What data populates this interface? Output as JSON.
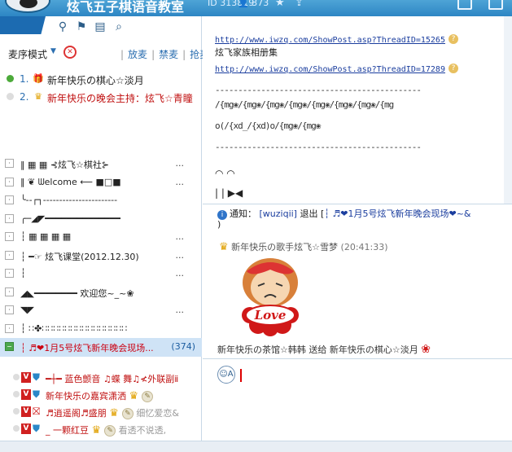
{
  "titlebar": {
    "app_title": "炫飞五子棋语音教室",
    "room_id": "ID 313819",
    "user_count": "373",
    "star_icon": "star-icon",
    "share_icon": "share-icon"
  },
  "toolbar": {
    "icons": [
      "people-icon",
      "location-icon",
      "notes-icon",
      "search-icon"
    ]
  },
  "mode_bar": {
    "mode_label": "麦序模式",
    "actions": [
      "放麦",
      "禁麦",
      "抢麦"
    ]
  },
  "queue": [
    {
      "num": "1.",
      "name": "新年快乐の棋心☆淡月",
      "color": "#222222",
      "dot_color": "#4caa3a"
    },
    {
      "num": "2.",
      "name": "新年快乐の晚会主持：炫飞☆青瞳",
      "color": "#c01010",
      "dot_color": "#dddddd"
    }
  ],
  "rooms": [
    {
      "name": "‖  ▦  ▦    ⊰炫飞☆棋社⊱",
      "dots": "...",
      "active": false
    },
    {
      "name": "‖   ❦ ᗯelcome  ⟵  ■□■",
      "dots": "...",
      "active": false
    },
    {
      "name": "╰--┌┐-----------------------",
      "dots": "",
      "active": false
    },
    {
      "name": "╭─◢◤━━━━━━━━━━━━━━",
      "dots": "",
      "active": false
    },
    {
      "name": "┆         ▦  ▦  ▦  ▦",
      "dots": "...",
      "active": false
    },
    {
      "name": "┆   ━☞   炫飞课堂(2012.12.30)",
      "dots": "...",
      "active": false
    },
    {
      "name": "┆",
      "dots": "...",
      "active": false
    },
    {
      "name": "◢◣━━━━━━━━   欢迎您~_~❀",
      "dots": "",
      "active": false
    },
    {
      "name": "◥◤",
      "dots": "...",
      "active": false
    },
    {
      "name": "┆        ∷✤∷∷∷∷∷∷∷∷∷∷∷∷∷∷∷",
      "dots": "",
      "active": false
    },
    {
      "name": "┆  ♬❤1月5号炫飞新年晚会现场...",
      "dots": "",
      "active": true,
      "count": "(374)"
    }
  ],
  "members": [
    {
      "name": "━┼━  蓝色颤音  ♫蝶   舞♫≮外联副ⅱ",
      "note": "",
      "avatar": "👕",
      "badge": ""
    },
    {
      "name": "新年快乐の嘉宾潇洒",
      "note": "",
      "avatar": "👕",
      "badge": "✎"
    },
    {
      "name": "♬逍遥阁♬盛朋",
      "note": "细忆爱恋&",
      "avatar": "🎁",
      "badge": "✎"
    },
    {
      "name": "_  一颗红豆",
      "note": "看透不说透,",
      "avatar": "👕",
      "badge": "✎"
    }
  ],
  "board": {
    "link1": "http://www.iwzq.com/ShowPost.asp?ThreadID=15265",
    "line1": "炫飞家族相册集",
    "link2": "http://www.iwzq.com/ShowPost.asp?ThreadID=17289",
    "dashes": "---------------------------------------------",
    "pattern": "/{mg❀/{mg❀/{mg❀/{mg❀/{mg❀/{mg❀/{mg❀/{mg",
    "pattern2": "o(/{xd_/{xd)o/{mg❀/{mg❀",
    "dashes2": "---------------------------------------------",
    "faces": "◠ ◠",
    "bars": "| |  ▶◀"
  },
  "chat": {
    "notice_label": "通知：",
    "notice_user": "[wuziqii]",
    "notice_action": "退出 [",
    "notice_room": "┆ ♬❤1月5号炫飞新年晚会现场❤~&",
    "notice_close": ")",
    "sender": "新年快乐の歌手炫飞☆雪梦",
    "time": "(20:41:33)",
    "sticker_word": "Love",
    "gift_from": "新年快乐の茶馆☆韩韩",
    "gift_verb": "送给",
    "gift_to": "新年快乐の棋心☆淡月"
  }
}
